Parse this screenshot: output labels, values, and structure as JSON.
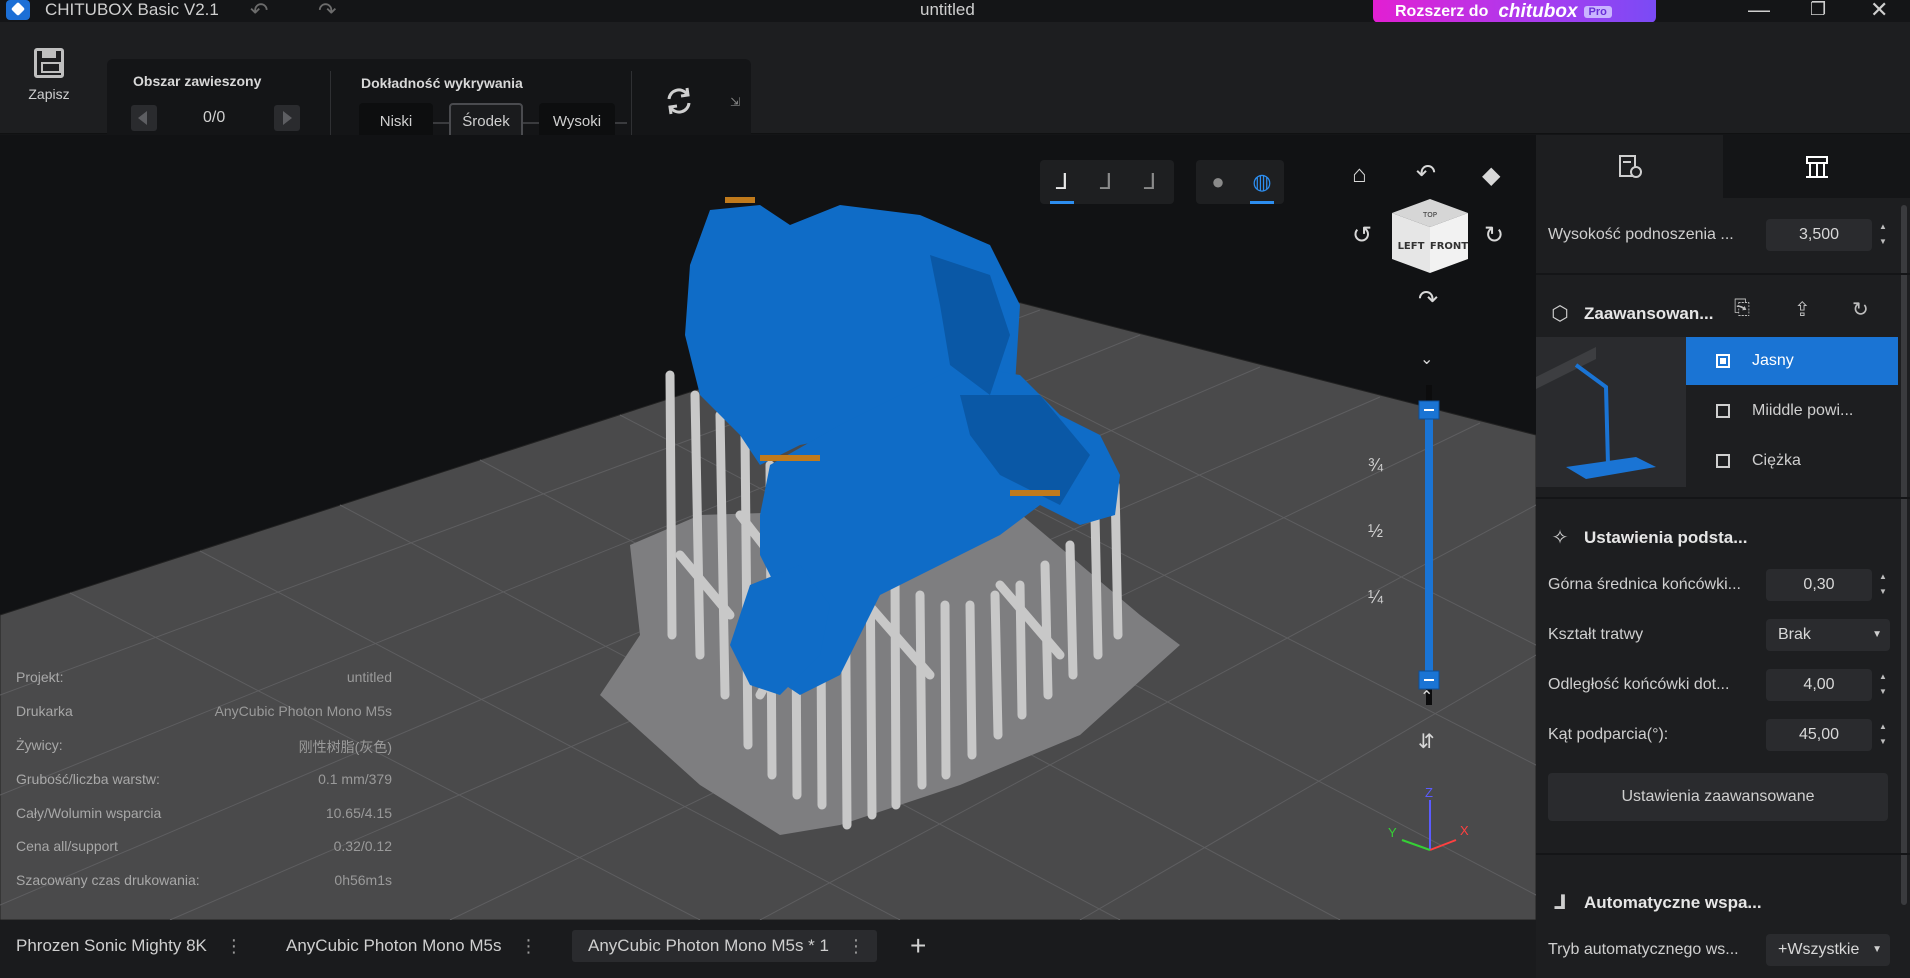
{
  "titlebar": {
    "app_title": "CHITUBOX Basic V2.1",
    "doc_title": "untitled",
    "upgrade_label": "Rozszerz do",
    "upgrade_brand": "chitubox",
    "upgrade_pro": "Pro",
    "undo_icon": "undo-icon",
    "redo_icon": "redo-icon"
  },
  "toolbar": {
    "save_label": "Zapisz",
    "suspended_area_label": "Obszar zawieszony",
    "suspended_counter": "0/0",
    "accuracy_label": "Dokładność wykrywania",
    "accuracy_options": [
      "Niski",
      "Środek",
      "Wysoki"
    ],
    "accuracy_selected": "Środek"
  },
  "viewport": {
    "cube_faces": {
      "top": "TOP",
      "left": "LEFT",
      "front": "FRONT"
    },
    "layer_labels": [
      "¾",
      "½",
      "¼"
    ],
    "axes": {
      "x": "X",
      "y": "Y",
      "z": "Z"
    },
    "accent_color": "#1a74d4"
  },
  "info": [
    {
      "label": "Projekt:",
      "value": "untitled"
    },
    {
      "label": "Drukarka",
      "value": "AnyCubic Photon Mono M5s"
    },
    {
      "label": "Żywicy:",
      "value": "刚性树脂(灰色)"
    },
    {
      "label": "Grubość/liczba warstw:",
      "value": "0.1 mm/379"
    },
    {
      "label": "Cały/Wolumin wsparcia",
      "value": "10.65/4.15"
    },
    {
      "label": "Cena all/support",
      "value": "0.32/0.12"
    },
    {
      "label": "Szacowany czas drukowania:",
      "value": "0h56m1s"
    }
  ],
  "bottom_tabs": [
    {
      "label": "Phrozen Sonic Mighty 8K",
      "active": false
    },
    {
      "label": "AnyCubic Photon Mono M5s",
      "active": false
    },
    {
      "label": "AnyCubic Photon Mono M5s * 1",
      "active": true
    }
  ],
  "rpanel": {
    "lift_height": {
      "label": "Wysokość podnoszenia ...",
      "value": "3,500"
    },
    "advanced_section": "Zaawansowan...",
    "presets": [
      {
        "label": "Jasny",
        "selected": true
      },
      {
        "label": "Miiddle powi...",
        "selected": false
      },
      {
        "label": "Ciężka",
        "selected": false
      }
    ],
    "basic_section": "Ustawienia podsta...",
    "fields": [
      {
        "label": "Górna średnica końcówki...",
        "value": "0,30",
        "type": "number"
      },
      {
        "label": "Kształt tratwy",
        "value": "Brak",
        "type": "select"
      },
      {
        "label": "Odległość końcówki dot...",
        "value": "4,00",
        "type": "number"
      },
      {
        "label": "Kąt podparcia(°):",
        "value": "45,00",
        "type": "number"
      }
    ],
    "advanced_button": "Ustawienia zaawansowane",
    "auto_section": "Automatyczne wspa...",
    "auto_mode": {
      "label": "Tryb automatycznego ws...",
      "value": "+Wszystkie"
    }
  }
}
